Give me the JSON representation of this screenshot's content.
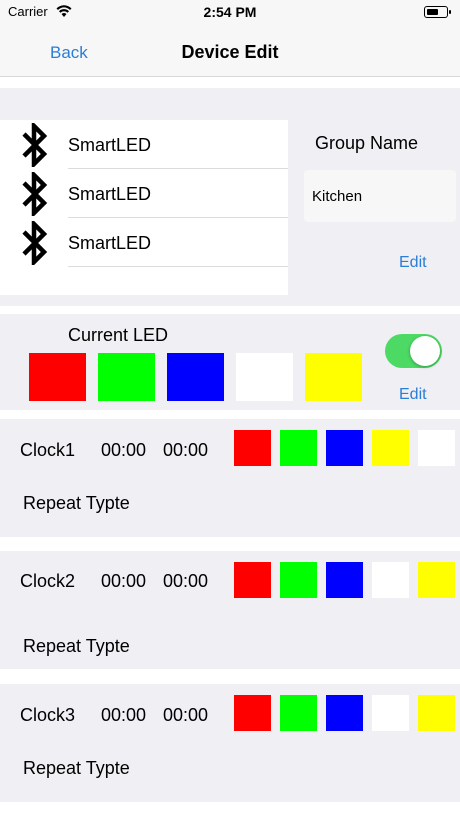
{
  "status_bar": {
    "carrier": "Carrier",
    "time": "2:54 PM"
  },
  "nav": {
    "back": "Back",
    "title": "Device Edit"
  },
  "devices": [
    "SmartLED",
    "SmartLED",
    "SmartLED"
  ],
  "group": {
    "label": "Group Name",
    "value": "Kitchen",
    "edit": "Edit"
  },
  "current_led": {
    "label": "Current LED",
    "colors": [
      "#ff0000",
      "#00ff00",
      "#0000ff",
      "#ffffff",
      "#ffff00"
    ],
    "toggle_on": true,
    "edit": "Edit"
  },
  "clocks": [
    {
      "name": "Clock1",
      "start": "00:00",
      "end": "00:00",
      "repeat": "Repeat Typte",
      "colors": [
        "#ff0000",
        "#00ff00",
        "#0000ff",
        "#ffff00",
        "#ffffff"
      ]
    },
    {
      "name": "Clock2",
      "start": "00:00",
      "end": "00:00",
      "repeat": "Repeat Typte",
      "colors": [
        "#ff0000",
        "#00ff00",
        "#0000ff",
        "#ffffff",
        "#ffff00"
      ]
    },
    {
      "name": "Clock3",
      "start": "00:00",
      "end": "00:00",
      "repeat": "Repeat Typte",
      "colors": [
        "#ff0000",
        "#00ff00",
        "#0000ff",
        "#ffffff",
        "#ffff00"
      ]
    }
  ]
}
